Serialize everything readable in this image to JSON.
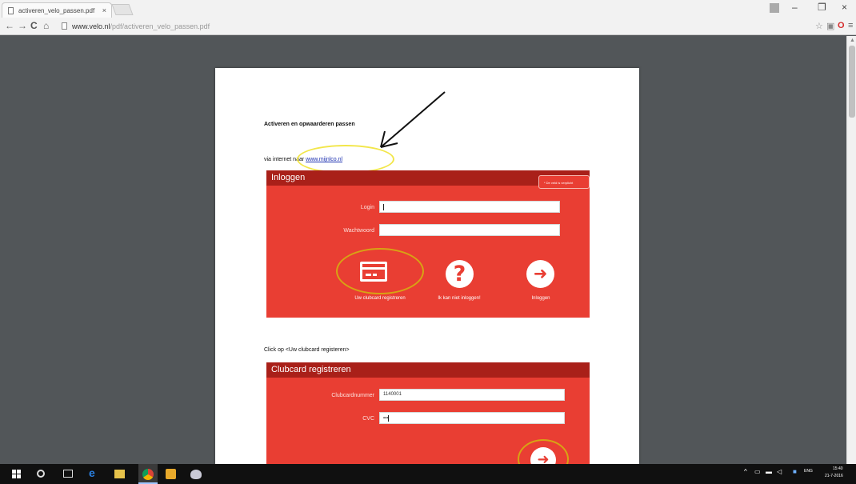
{
  "browser": {
    "tab_title": "activeren_velo_passen.pdf",
    "tab_close": "×",
    "url_host": "www.velo.nl",
    "url_path": "/pdf/activeren_velo_passen.pdf",
    "icons": [
      "back-icon",
      "forward-icon",
      "reload-icon",
      "home-icon",
      "star-icon",
      "extension-icon",
      "opera-icon",
      "menu-icon"
    ],
    "window_buttons": [
      "–",
      "❐",
      "×"
    ]
  },
  "document": {
    "title": "Activeren en opwaarderen passen",
    "via_prefix": "via internet naar ",
    "via_link": "www.mijnlco.nl",
    "login_panel": {
      "header": "Inloggen",
      "tooltip": "* De veld is verplicht",
      "login_label": "Login",
      "password_label": "Wachtwoord",
      "actions": [
        {
          "label": "Uw clubcard registreren",
          "icon": "card-icon"
        },
        {
          "label": "Ik kan niet inloggen!",
          "icon": "question-icon"
        },
        {
          "label": "Inloggen",
          "icon": "arrow-right-icon"
        }
      ]
    },
    "click_instruction": "Click op <Uw clubcard registeren>",
    "register_panel": {
      "header": "Clubcard registreren",
      "card_number_label": "Clubcardnummer",
      "card_number_value": "1140001",
      "cvc_label": "CVC",
      "cvc_value": "•••"
    }
  },
  "taskbar": {
    "time": "15:40",
    "date": "21-7-2016",
    "lang": "ENG"
  },
  "colors": {
    "panel_red": "#e93e33",
    "header_red": "#a92019",
    "highlight_yellow": "#f2e64a",
    "highlight_gold": "#d8a314"
  }
}
